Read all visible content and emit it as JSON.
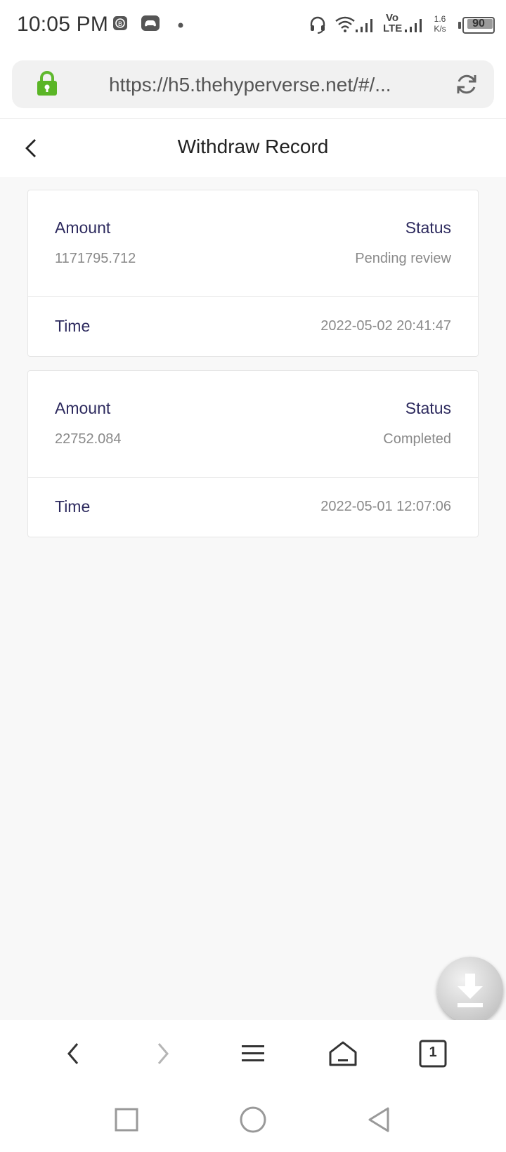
{
  "status_bar": {
    "time": "10:05 PM",
    "network_speed": "1.6 K/s",
    "network_type": "Vo LTE",
    "battery": 90,
    "icons": [
      "bitcoin-app-icon",
      "gamepad-icon",
      "dot-icon",
      "headset-icon",
      "wifi-icon",
      "signal-icon",
      "battery-icon"
    ]
  },
  "browser": {
    "url": "https://h5.thehyperverse.net/#/...",
    "tab_count": "1",
    "lock_color": "#4caf2a"
  },
  "page": {
    "title": "Withdraw Record"
  },
  "records": [
    {
      "amount_label": "Amount",
      "amount": "1171795.712",
      "status_label": "Status",
      "status": "Pending review",
      "time_label": "Time",
      "time": "2022-05-02 20:41:47"
    },
    {
      "amount_label": "Amount",
      "amount": "22752.084",
      "status_label": "Status",
      "status": "Completed",
      "time_label": "Time",
      "time": "2022-05-01 12:07:06"
    }
  ],
  "colors": {
    "label": "#2d2a5e",
    "value": "#8a8a8a",
    "background": "#f8f8f8"
  }
}
